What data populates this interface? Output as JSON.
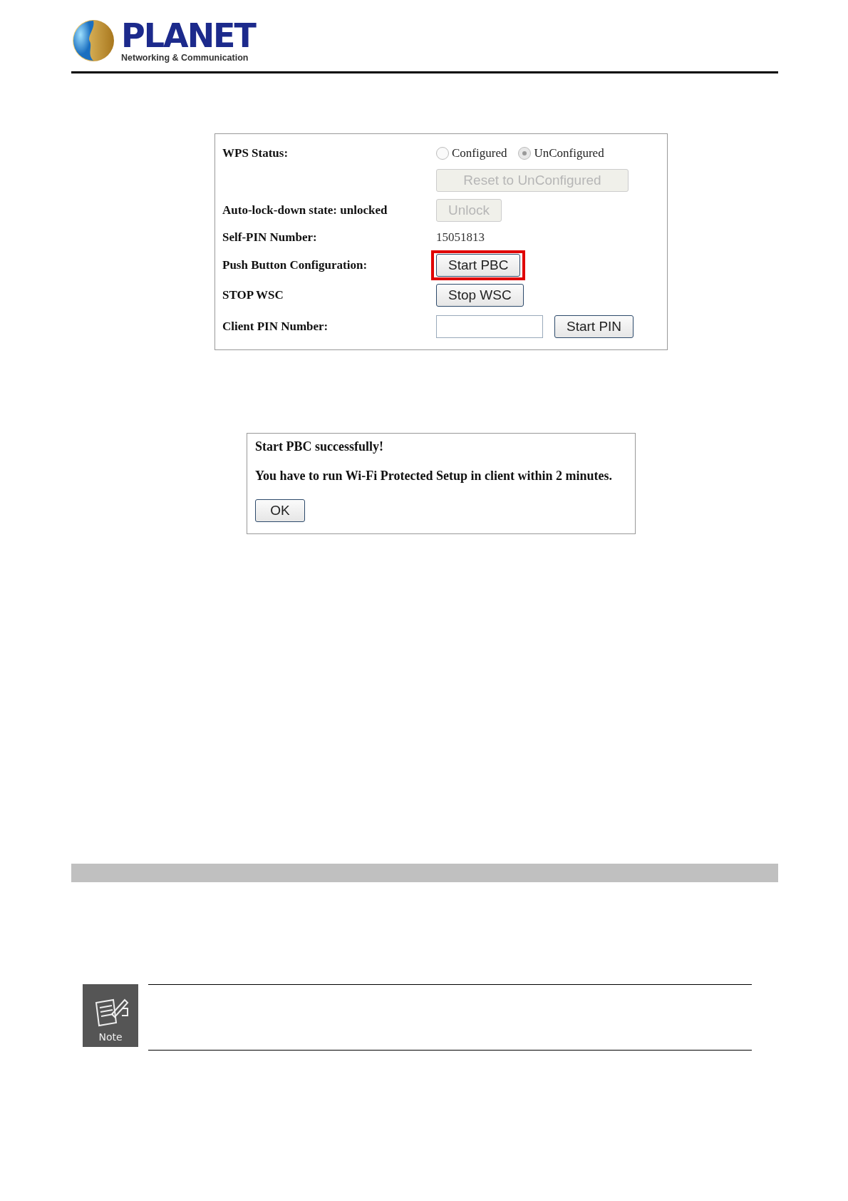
{
  "header": {
    "logo_name": "PLANET",
    "logo_tagline": "Networking & Communication"
  },
  "wps_panel": {
    "rows": [
      {
        "kind": "radio",
        "label": "WPS Status:",
        "options": [
          {
            "label": "Configured",
            "selected": false
          },
          {
            "label": "UnConfigured",
            "selected": true
          }
        ]
      },
      {
        "kind": "button",
        "button": {
          "label": "Reset to UnConfigured",
          "disabled": true,
          "highlighted": false
        }
      },
      {
        "kind": "button",
        "label": "Auto-lock-down state: unlocked",
        "button": {
          "label": "Unlock",
          "disabled": true,
          "highlighted": false
        }
      },
      {
        "kind": "value",
        "label": "Self-PIN Number:",
        "value": "15051813"
      },
      {
        "kind": "button",
        "label": "Push Button Configuration:",
        "button": {
          "label": "Start PBC",
          "disabled": false,
          "highlighted": true
        }
      },
      {
        "kind": "button",
        "label": "STOP WSC",
        "button": {
          "label": "Stop WSC",
          "disabled": false,
          "highlighted": false
        }
      },
      {
        "kind": "input",
        "label": "Client PIN Number:",
        "button": {
          "label": "Start PIN",
          "disabled": false,
          "highlighted": false
        }
      }
    ]
  },
  "dialog": {
    "title": "Start PBC successfully!",
    "message": "You have to run Wi-Fi Protected Setup in client within 2 minutes.",
    "button": "OK"
  },
  "note": {
    "icon_label": "Note"
  }
}
